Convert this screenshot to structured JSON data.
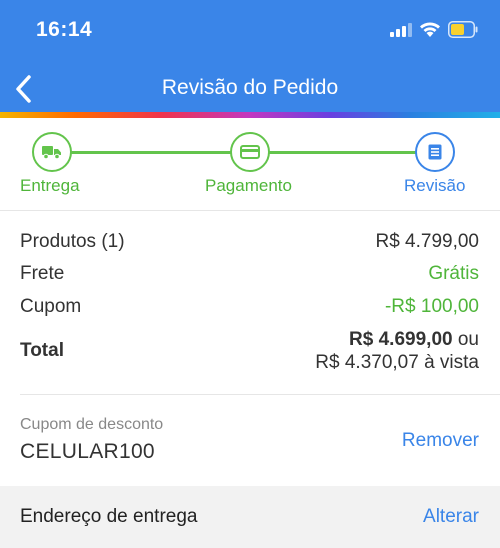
{
  "status_bar": {
    "time": "16:14"
  },
  "nav": {
    "title": "Revisão do Pedido"
  },
  "stepper": {
    "steps": [
      {
        "label": "Entrega",
        "icon": "truck-icon",
        "state": "done"
      },
      {
        "label": "Pagamento",
        "icon": "credit-card-icon",
        "state": "done"
      },
      {
        "label": "Revisão",
        "icon": "document-icon",
        "state": "active"
      }
    ],
    "colors": {
      "done": "#63c44c",
      "active": "#3a85e8"
    }
  },
  "summary": {
    "products_label": "Produtos (1)",
    "products_value": "R$ 4.799,00",
    "shipping_label": "Frete",
    "shipping_value": "Grátis",
    "coupon_label": "Cupom",
    "coupon_value": "-R$ 100,00",
    "total_label": "Total",
    "total_value": "R$ 4.699,00",
    "total_or": "ou",
    "total_cash": "R$ 4.370,07 à vista"
  },
  "coupon": {
    "label": "Cupom de desconto",
    "code": "CELULAR100",
    "remove_label": "Remover"
  },
  "address": {
    "title": "Endereço de entrega",
    "change_label": "Alterar"
  },
  "colors": {
    "primary": "#3a85e8",
    "success": "#4fb53a"
  }
}
